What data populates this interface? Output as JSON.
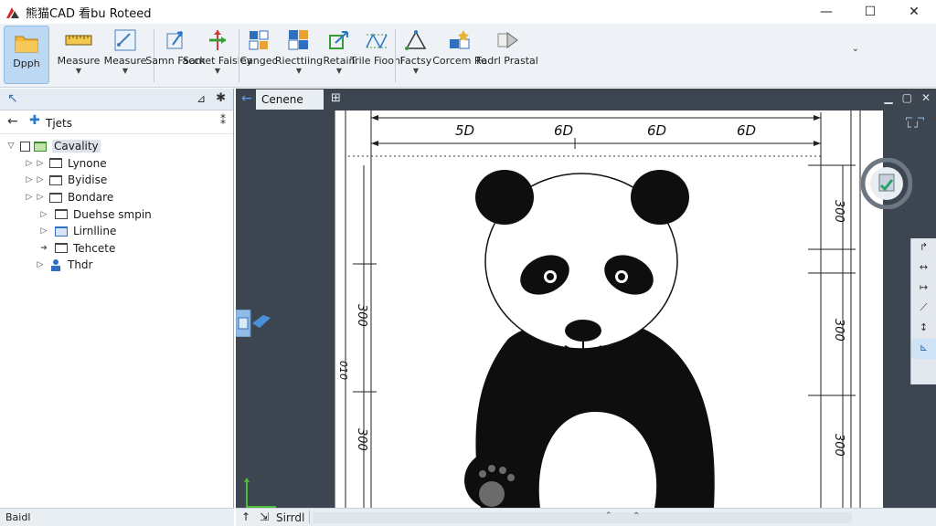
{
  "window": {
    "title": "熊猫CAD 看bu Roteed",
    "minimize": "—",
    "maximize": "☐",
    "close": "✕"
  },
  "ribbon": {
    "buttons": [
      {
        "label": "Dpph",
        "active": true,
        "dropdown": false
      },
      {
        "label": "Measure",
        "dropdown": true
      },
      {
        "label": "Measure",
        "dropdown": true
      },
      {
        "label": "Samn Facck",
        "dropdown": false
      },
      {
        "label": "Samet Faisley",
        "dropdown": true
      },
      {
        "label": "Cangec",
        "dropdown": false
      },
      {
        "label": "Riecttiing",
        "dropdown": true
      },
      {
        "label": "Retain",
        "dropdown": true
      },
      {
        "label": "Trile Fioonl",
        "dropdown": false
      },
      {
        "label": "Factsy",
        "dropdown": true
      },
      {
        "label": "Corcem Re",
        "dropdown": false
      },
      {
        "label": "Fadrl Prastal",
        "dropdown": false
      }
    ],
    "collapse_glyph": "⌄"
  },
  "left_panel": {
    "back_glyph": "↖",
    "pin_glyph": "⊿",
    "close_glyph": "✱",
    "toolbar": {
      "title": "Tjets",
      "menu_glyph": "⁑"
    },
    "tree": [
      {
        "label": "Cavality",
        "level": 0,
        "selected": true,
        "expanded": true,
        "icon": "folder-green-icon"
      },
      {
        "label": "Lynone",
        "level": 1,
        "icon": "folder-icon"
      },
      {
        "label": "Byidise",
        "level": 1,
        "icon": "folder-icon"
      },
      {
        "label": "Bondare",
        "level": 1,
        "icon": "folder-icon"
      },
      {
        "label": "Duehse smpin",
        "level": 2,
        "icon": "folder-icon"
      },
      {
        "label": "Lirnlline",
        "level": 2,
        "icon": "layer-icon"
      },
      {
        "label": "Tehcete",
        "level": 2,
        "icon": "folder-icon"
      },
      {
        "label": "Thdr",
        "level": 1,
        "icon": "user-icon"
      }
    ]
  },
  "document": {
    "tab_label": "Cenene",
    "dimensions_top": [
      "5D",
      "6D",
      "6D",
      "6D"
    ],
    "dimensions_left": [
      "300",
      "010",
      "300"
    ],
    "dimensions_right": [
      "300",
      "300",
      "300"
    ],
    "drawing_subject": "panda"
  },
  "status": {
    "left_text": "Baidl",
    "main_text": "Sirrdl",
    "scroll_left": "⌃",
    "scroll_right": "⌃"
  },
  "colors": {
    "ribbon_bg": "#eef2f6",
    "active_button": "#bdd8f2",
    "workspace_bg": "#3d4650",
    "accent": "#2b78c9"
  }
}
